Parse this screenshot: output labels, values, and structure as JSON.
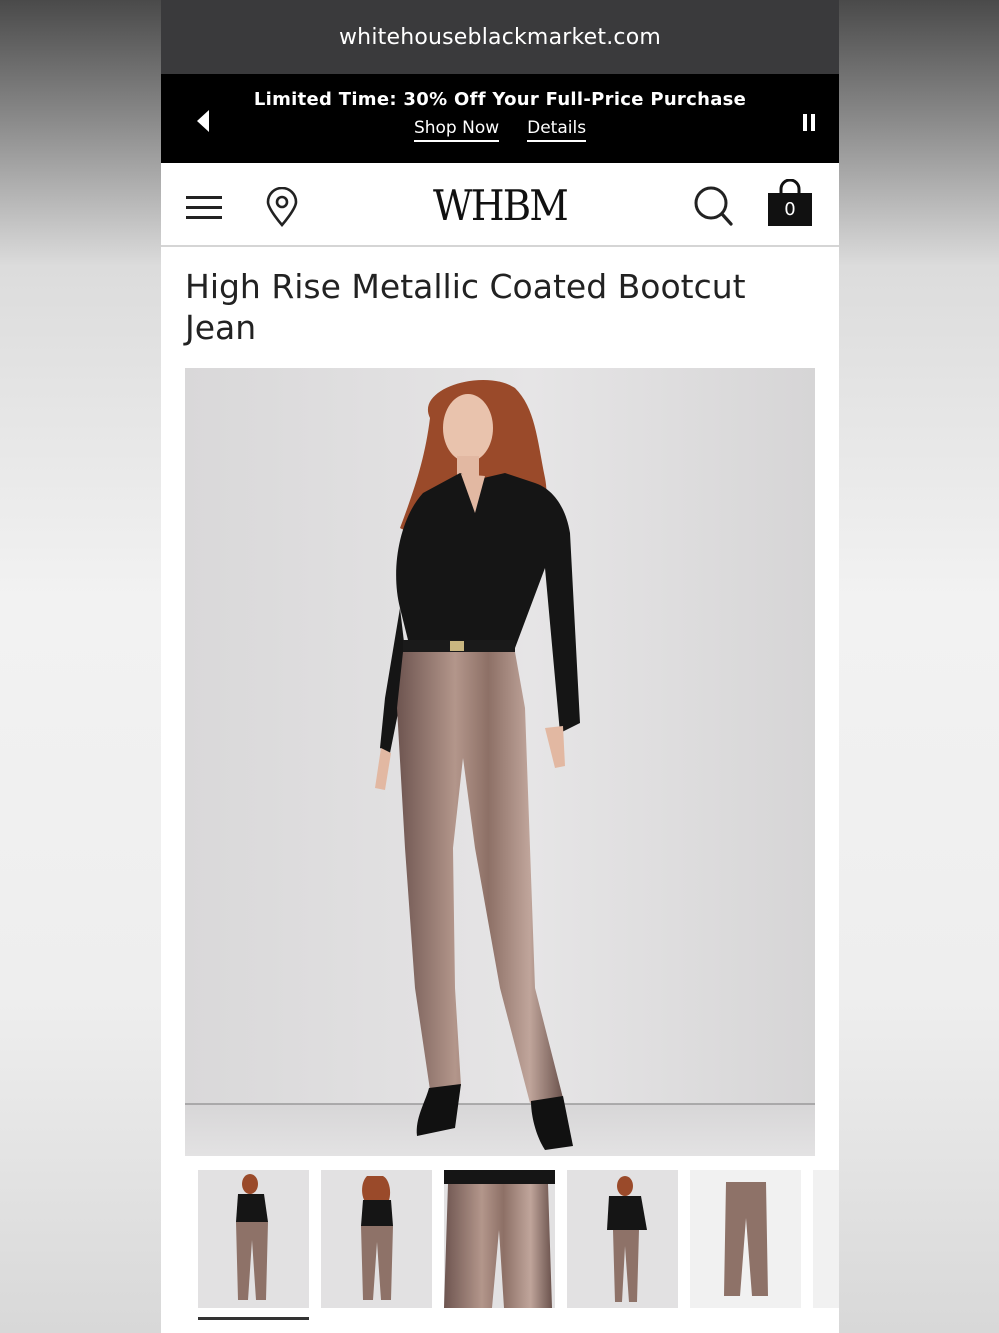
{
  "browser": {
    "url": "whitehouseblackmarket.com"
  },
  "promo": {
    "headline": "Limited Time: 30% Off Your Full-Price Purchase",
    "shop_now": "Shop Now",
    "details": "Details",
    "prev_icon": "caret-left-icon",
    "pause_icon": "pause-icon"
  },
  "header": {
    "logo": "WHBM",
    "menu_icon": "hamburger-menu-icon",
    "store_icon": "location-pin-icon",
    "search_icon": "search-icon",
    "bag_icon": "shopping-bag-icon",
    "bag_count": "0"
  },
  "product": {
    "title": "High Rise Metallic Coated Bootcut Jean",
    "thumbnails": [
      {
        "name": "front-full",
        "selected": true
      },
      {
        "name": "back-full",
        "selected": false
      },
      {
        "name": "detail-closeup",
        "selected": false
      },
      {
        "name": "front-with-jacket",
        "selected": false
      },
      {
        "name": "flat-lay",
        "selected": false
      }
    ]
  },
  "colors": {
    "promo_bg": "#000000",
    "urlbar_bg": "#3a3a3c",
    "metallic": "#8e7268",
    "shirt": "#151515"
  }
}
